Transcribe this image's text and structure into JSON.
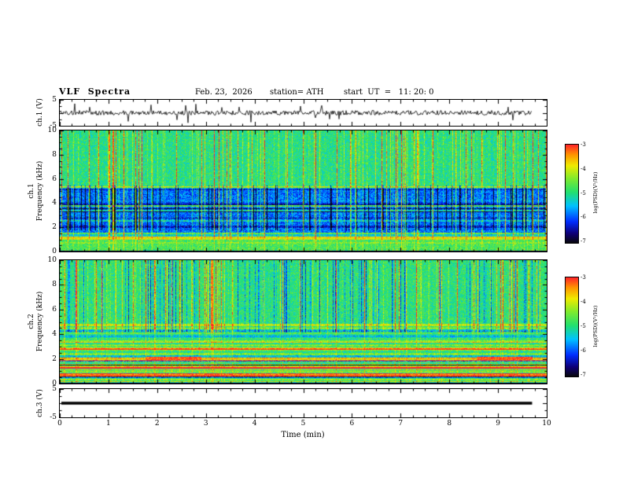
{
  "header": {
    "title": "VLF  Spectra",
    "date": "Feb. 23,  2026",
    "station": "station= ATH",
    "start_ut": "start  UT  =   11: 20: 0"
  },
  "x_axis": {
    "label": "Time  (min)",
    "ticks": [
      0,
      1,
      2,
      3,
      4,
      5,
      6,
      7,
      8,
      9,
      10
    ],
    "range": [
      0,
      10
    ]
  },
  "panels": {
    "ch1_wave": {
      "ylabel": "ch.1 (V)",
      "yticks": [
        5,
        -5
      ],
      "ylim": [
        -5,
        5
      ]
    },
    "ch1_spec": {
      "ylabel_line1": "ch.1",
      "ylabel_line2": "Frequency  (kHz)",
      "yticks": [
        10,
        8,
        6,
        4,
        2,
        0
      ],
      "ylim": [
        0,
        10
      ]
    },
    "ch2_spec": {
      "ylabel_line1": "ch.2",
      "ylabel_line2": "Frequency  (kHz)",
      "yticks": [
        10,
        8,
        6,
        4,
        2,
        0
      ],
      "ylim": [
        0,
        10
      ]
    },
    "ch3_wave": {
      "ylabel": "ch.3 (V)",
      "yticks": [
        5,
        -5
      ],
      "ylim": [
        -5,
        5
      ]
    }
  },
  "colorbars": [
    {
      "label": "log(PSD)(V²/Hz)",
      "ticks": [
        -3,
        -4,
        -5,
        -6,
        -7
      ],
      "range": [
        -7,
        -3
      ]
    },
    {
      "label": "log(PSD)(V²/Hz)",
      "ticks": [
        -3,
        -4,
        -5,
        -6,
        -7
      ],
      "range": [
        -7,
        -3
      ]
    }
  ],
  "chart_data": [
    {
      "type": "line",
      "title": "ch.1 time series",
      "xlabel": "Time (min)",
      "ylabel": "ch.1 (V)",
      "xlim": [
        0,
        10
      ],
      "ylim": [
        -5,
        5
      ],
      "series": [
        {
          "name": "ch.1 (V)",
          "description": "continuous broadband noisy waveform centred on 0 V, typical amplitude about ±1 V, with frequent impulsive spikes reaching roughly ±4 V; data extend from 0 to about 9.7 min"
        }
      ]
    },
    {
      "type": "heatmap",
      "title": "ch.1 VLF spectrogram",
      "xlabel": "Time (min)",
      "ylabel": "Frequency (kHz)",
      "xlim": [
        0,
        10
      ],
      "ylim": [
        0,
        10
      ],
      "zlabel": "log(PSD)(V²/Hz)",
      "zlim": [
        -7,
        -3
      ],
      "legend_position": "right colorbar, red (-3) to black (-7)",
      "description": "green background near -5 above ~5 kHz crossed by dense vertical sferic streaks (bright yellow-green and some dark blue); dark blue band near -6 between ~2 and 5 kHz with many bright/dark vertical stripes and thin horizontal lines; bright cyan-green horizontal line near 3.8 kHz; yellow-green horizontal banding below ~1.5 kHz; thin dark band at 0 kHz"
    },
    {
      "type": "heatmap",
      "title": "ch.2 VLF spectrogram",
      "xlabel": "Time (min)",
      "ylabel": "Frequency (kHz)",
      "xlim": [
        0,
        10
      ],
      "ylim": [
        0,
        10
      ],
      "zlabel": "log(PSD)(V²/Hz)",
      "zlim": [
        -7,
        -3
      ],
      "legend_position": "right colorbar, red (-3) to black (-7)",
      "description": "green-yellow field with vertical sferic streaks above ~4.5 kHz; dense horizontal green/yellow striations between 0 and ~4.5 kHz; strong red-brown horizontal line near 2 kHz during ~1.8-2.9 min and ~8.6-9.7 min; dark navy horizontal lines near 0.5 and 1.5 kHz; thin dark band at 0 kHz"
    },
    {
      "type": "line",
      "title": "ch.3 time series",
      "xlabel": "Time (min)",
      "ylabel": "ch.3 (V)",
      "xlim": [
        0,
        10
      ],
      "ylim": [
        -5,
        5
      ],
      "series": [
        {
          "name": "ch.3 (V)",
          "description": "flat thick black line at 0 V (no signal) from 0 to about 9.7 min"
        }
      ]
    }
  ]
}
